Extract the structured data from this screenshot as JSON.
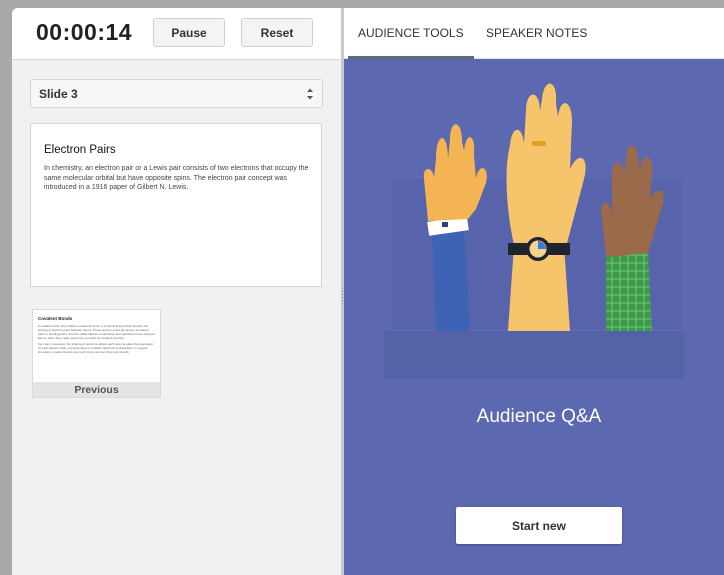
{
  "timer": {
    "value": "00:00:14",
    "pause_label": "Pause",
    "reset_label": "Reset"
  },
  "slide_selector": {
    "value": "Slide 3"
  },
  "current_slide": {
    "title": "Electron Pairs",
    "body": "In chemistry, an electron pair or a Lewis pair consists of two electrons that occupy the same molecular orbital but have opposite spins. The electron pair concept was introduced in a 1916 paper of Gilbert N. Lewis."
  },
  "previous_slide": {
    "title": "Covalent Bonds",
    "body_1": "A covalent bond, also called a molecular bond, is a chemical bond that involves the sharing of electron pairs between atoms. These electron pairs are known as shared pairs or bonding pairs, and the stable balance of attractive and repulsive forces between atoms, when they share electrons, is known as covalent bonding.",
    "body_2": "For many molecules, the sharing of electrons allows each atom to attain the equivalent of a full valence shell, corresponding to a stable electronic configuration. In organic chemistry, covalent bonds are much more common than ionic bonds.",
    "label": "Previous"
  },
  "tabs": [
    {
      "label": "AUDIENCE TOOLS",
      "active": true
    },
    {
      "label": "SPEAKER NOTES",
      "active": false
    }
  ],
  "audience": {
    "title": "Audience Q&A",
    "start_label": "Start new"
  },
  "colors": {
    "panel_bg": "#5c68b0",
    "tab_underline": "#546e7a"
  },
  "icons": [
    "chevron-updown-icon",
    "raised-hands-illustration"
  ]
}
